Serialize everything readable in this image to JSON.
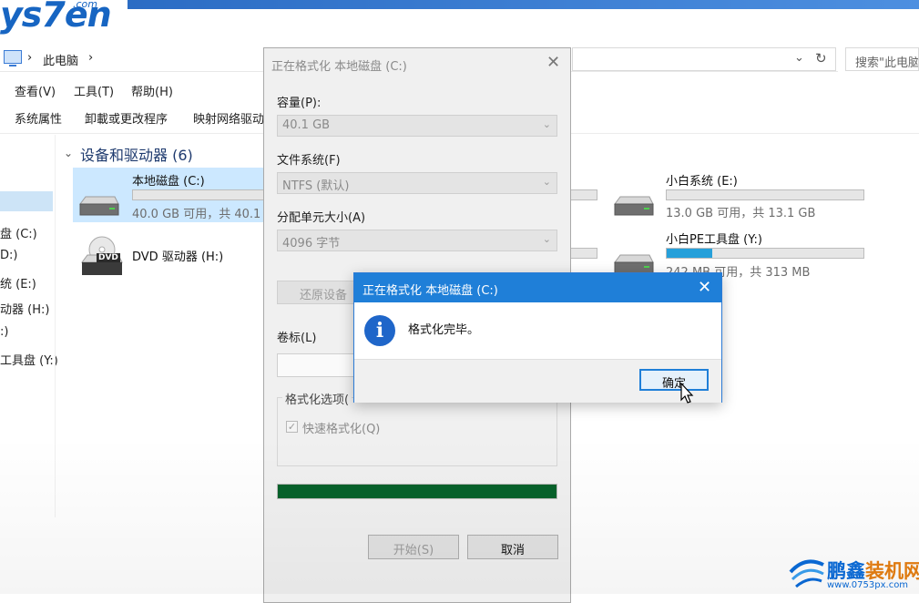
{
  "brand": {
    "logo_text": "ys7en",
    "logo_small": ".com"
  },
  "address": {
    "crumb_root": "此电脑",
    "search_placeholder": "搜索\"此电脑\""
  },
  "menu": {
    "items": [
      "查看(V)",
      "工具(T)",
      "帮助(H)"
    ]
  },
  "commandbar": {
    "items": [
      "系统属性",
      "卸載或更改程序",
      "映射网络驱动"
    ]
  },
  "nav": {
    "items": [
      "盘 (C:)",
      "D:)",
      "统 (E:)",
      "动器 (H:)",
      ":)",
      "工具盘 (Y:)"
    ]
  },
  "group": {
    "title": "设备和驱动器 (6)"
  },
  "drives": {
    "c": {
      "name": "本地磁盘 (C:)",
      "info": "40.0 GB 可用，共 40.1",
      "fill": 0.0
    },
    "h": {
      "name": "DVD 驱动器 (H:)",
      "badge": "DVD"
    },
    "e": {
      "name": "小白系统 (E:)",
      "info": "13.0 GB 可用，共 13.1 GB",
      "fill": 0.0
    },
    "y": {
      "name": "小白PE工具盘 (Y:)",
      "info": "242 MB 可用，共 313 MB",
      "fill": 0.23
    }
  },
  "format_dialog": {
    "title": "正在格式化 本地磁盘 (C:)",
    "capacity_label": "容量(P):",
    "capacity_value": "40.1 GB",
    "fs_label": "文件系统(F)",
    "fs_value": "NTFS (默认)",
    "alloc_label": "分配单元大小(A)",
    "alloc_value": "4096 字节",
    "restore_button": "还原设备",
    "volume_label": "卷标(L)",
    "options_label": "格式化选项(",
    "quick_format": "快速格式化(Q)",
    "quick_checked": true,
    "progress": 1.0,
    "start_button": "开始(S)",
    "cancel_button": "取消"
  },
  "message_box": {
    "title": "正在格式化 本地磁盘 (C:)",
    "text": "格式化完毕。",
    "ok_button": "确定"
  },
  "watermark": {
    "part1": "鹏鑫",
    "part2": "装机网",
    "url": "www.0753px.com"
  },
  "colors": {
    "accent": "#1f7fd8",
    "progress": "#06612b",
    "selection": "#cce8ff"
  }
}
